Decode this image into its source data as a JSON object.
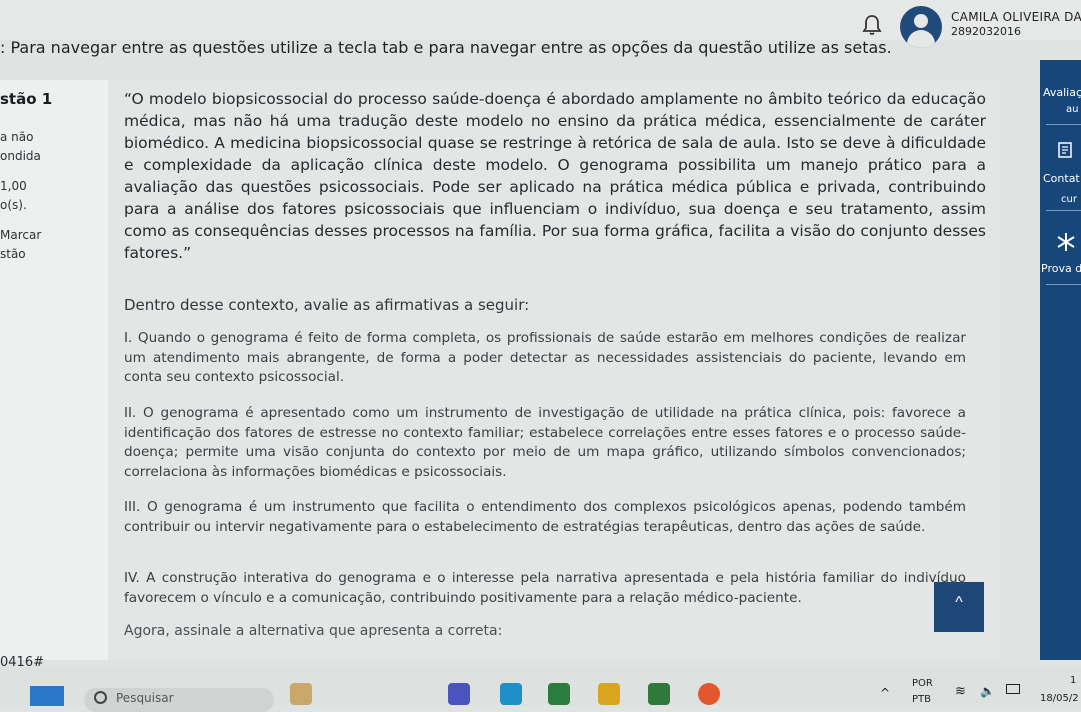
{
  "header": {
    "user_name": "CAMILA OLIVEIRA DA",
    "user_id": "2892032016"
  },
  "instructions": ": Para navegar entre as questões utilize a tecla tab e para navegar entre as opções da questão utilize as setas.",
  "sidebar_left": {
    "question_label": "stão 1",
    "lines": [
      "a não",
      "ondida",
      "1,00",
      "o(s).",
      "Marcar",
      "stão"
    ],
    "bottom_code": "0416#"
  },
  "question": {
    "quote": "“O modelo biopsicossocial do processo saúde-doença é abordado amplamente no âmbito teórico da educação médica, mas não há uma tradução deste modelo no ensino da prática médica, essencialmente de caráter biomédico. A medicina biopsicossocial quase se restringe à retórica de sala de aula. Isto se deve à dificuldade e complexidade da aplicação clínica deste modelo. O genograma possibilita um manejo prático para a avaliação das questões psicossociais. Pode ser aplicado na prática médica pública e privada, contribuindo para a análise dos fatores psicossociais que influenciam o indivíduo, sua doença e seu tratamento, assim como as consequências desses processos na família. Por sua forma gráfica, facilita a visão do conjunto desses fatores.”",
    "prompt": "Dentro desse contexto, avalie as afirmativas a seguir:",
    "statements": [
      "I. Quando o genograma é feito de forma completa, os profissionais de saúde estarão em melhores condições de realizar um atendimento mais abrangente, de forma a poder detectar as necessidades assistenciais do paciente, levando em conta seu contexto psicossocial.",
      "II. O genograma é apresentado como um instrumento de investigação de utilidade na prática clínica, pois: favorece a identificação dos fatores de estresse no contexto familiar; estabelece correlações entre esses fatores e o processo saúde-doença; permite uma visão conjunta do contexto por meio de um mapa gráfico, utilizando símbolos convencionados; correlaciona às informações biomédicas e psicossociais.",
      "III. O genograma é um instrumento que facilita o entendimento dos complexos psicológicos apenas, podendo também contribuir ou intervir negativamente para o estabelecimento de estratégias terapêuticas, dentro das ações de saúde.",
      "IV. A construção interativa do genograma e o interesse pela narrativa apresentada e pela história familiar do indivíduo favorecem o vínculo e a comunicação, contribuindo positivamente para a relação médico-paciente."
    ],
    "final": "Agora, assinale a alternativa que apresenta a correta:"
  },
  "sidebar_right": {
    "items": [
      "Avaliaç",
      "au",
      "Contat",
      "cur",
      "Prova d"
    ]
  },
  "taskbar": {
    "search_placeholder": "Pesquisar",
    "lang_top": "POR",
    "lang_bottom": "PTB",
    "time": "1",
    "date": "18/05/2"
  },
  "colors": {
    "accent": "#17477a",
    "page_bg": "#e3e6e4"
  }
}
